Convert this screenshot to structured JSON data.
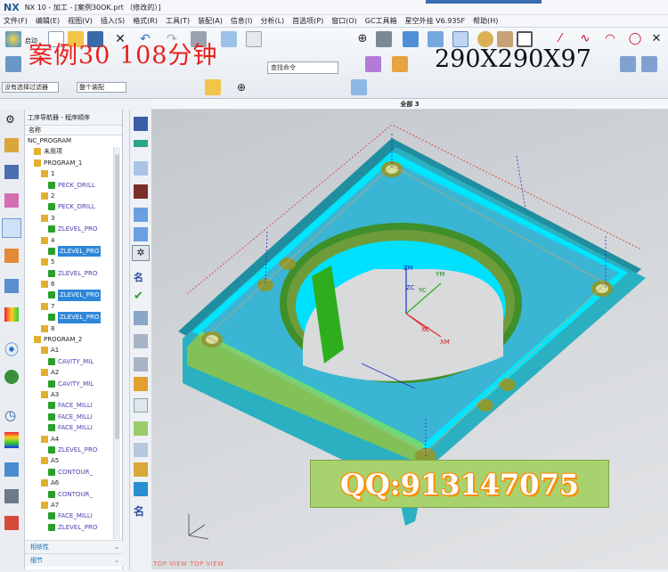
{
  "window": {
    "app_logo": "NX",
    "title": "NX 10 - 加工 - [案例30OK.prt （修改的）]"
  },
  "menu": [
    "文件(F)",
    "编辑(E)",
    "视图(V)",
    "插入(S)",
    "格式(R)",
    "工具(T)",
    "装配(A)",
    "信息(I)",
    "分析(L)",
    "首选项(P)",
    "窗口(O)",
    "GC工具箱",
    "星空外挂 V6.935F",
    "帮助(H)"
  ],
  "toolbar": {
    "start_label": "启动",
    "search_placeholder": "查找命令",
    "selection_filter": "没有选择过滤器",
    "assembly_scope": "整个装配"
  },
  "overlay": {
    "case_title": "案例30 108分钟",
    "dimensions": "290X290X97"
  },
  "view_header": "全部 3",
  "navigator": {
    "title": "工序导航器 - 程序顺序",
    "column": "名称",
    "root": "NC_PROGRAM",
    "rows": [
      {
        "text": "未用项",
        "indent": 8,
        "sel": false
      },
      {
        "text": "PROGRAM_1",
        "indent": 8,
        "sel": false
      },
      {
        "text": "1",
        "indent": 16,
        "sel": false
      },
      {
        "text": "PECK_DRILL",
        "indent": 24,
        "sel": false,
        "op": true
      },
      {
        "text": "2",
        "indent": 16,
        "sel": false
      },
      {
        "text": "PECK_DRILL",
        "indent": 24,
        "sel": false,
        "op": true
      },
      {
        "text": "3",
        "indent": 16,
        "sel": false
      },
      {
        "text": "ZLEVEL_PRO",
        "indent": 24,
        "sel": false,
        "op": true
      },
      {
        "text": "4",
        "indent": 16,
        "sel": false
      },
      {
        "text": "ZLEVEL_PRO",
        "indent": 24,
        "sel": true,
        "op": true
      },
      {
        "text": "5",
        "indent": 16,
        "sel": false
      },
      {
        "text": "ZLEVEL_PRO",
        "indent": 24,
        "sel": false,
        "op": true
      },
      {
        "text": "6",
        "indent": 16,
        "sel": false
      },
      {
        "text": "ZLEVEL_PRO",
        "indent": 24,
        "sel": true,
        "op": true
      },
      {
        "text": "7",
        "indent": 16,
        "sel": false
      },
      {
        "text": "ZLEVEL_PRO",
        "indent": 24,
        "sel": true,
        "op": true
      },
      {
        "text": "8",
        "indent": 16,
        "sel": false
      },
      {
        "text": "PROGRAM_2",
        "indent": 8,
        "sel": false
      },
      {
        "text": "A1",
        "indent": 16,
        "sel": false
      },
      {
        "text": "CAVITY_MIL",
        "indent": 24,
        "sel": false,
        "op": true
      },
      {
        "text": "A2",
        "indent": 16,
        "sel": false
      },
      {
        "text": "CAVITY_MIL",
        "indent": 24,
        "sel": false,
        "op": true
      },
      {
        "text": "A3",
        "indent": 16,
        "sel": false
      },
      {
        "text": "FACE_MILLI",
        "indent": 24,
        "sel": false,
        "op": true
      },
      {
        "text": "FACE_MILLI",
        "indent": 24,
        "sel": false,
        "op": true
      },
      {
        "text": "FACE_MILLI",
        "indent": 24,
        "sel": false,
        "op": true
      },
      {
        "text": "A4",
        "indent": 16,
        "sel": false
      },
      {
        "text": "ZLEVEL_PRO",
        "indent": 24,
        "sel": false,
        "op": true
      },
      {
        "text": "A5",
        "indent": 16,
        "sel": false
      },
      {
        "text": "CONTOUR_",
        "indent": 24,
        "sel": false,
        "op": true
      },
      {
        "text": "A6",
        "indent": 16,
        "sel": false
      },
      {
        "text": "CONTOUR_",
        "indent": 24,
        "sel": false,
        "op": true
      },
      {
        "text": "A7",
        "indent": 16,
        "sel": false
      },
      {
        "text": "FACE_MILLI",
        "indent": 24,
        "sel": false,
        "op": true
      },
      {
        "text": "ZLEVEL_PRO",
        "indent": 24,
        "sel": false,
        "op": true
      }
    ]
  },
  "bottom_tabs": [
    "相依性",
    "细节"
  ],
  "coords": {
    "zm": "ZM",
    "ym": "YM",
    "zc": "ZC",
    "yc": "YC",
    "xc": "XC",
    "xm": "XM"
  },
  "watermark": "QQ:913147075",
  "view_labels": "TOP VIEW   TOP VIEW",
  "colors": {
    "part": "#3ab6d4",
    "part_top": "#00e6ff",
    "selection": "#2d87d9",
    "hole": "#8a9a35",
    "wall": "#2fae1d"
  }
}
